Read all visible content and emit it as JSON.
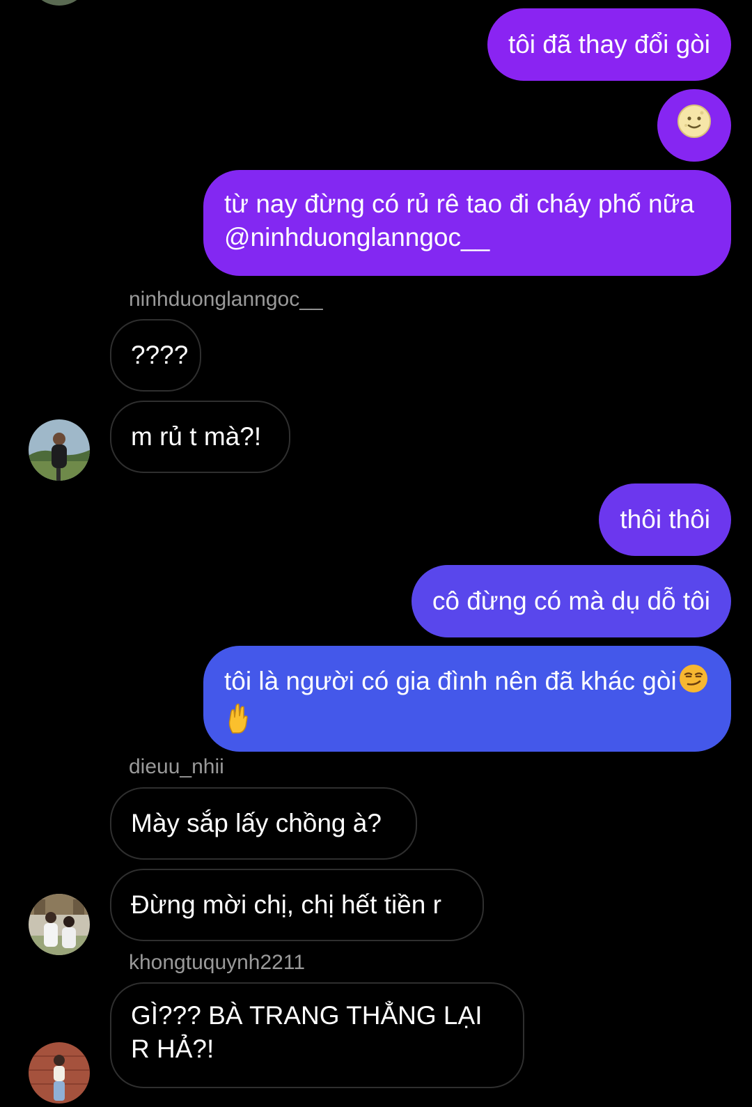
{
  "messages": [
    {
      "from": "me",
      "text": "tôi đã thay đổi gòi"
    },
    {
      "from": "me",
      "emoji": "slightly-smiling-moon-face-icon"
    },
    {
      "from": "me",
      "text": "từ nay đừng có rủ rê tao đi cháy phố nữa @ninhduonglanngoc__"
    },
    {
      "from": "ninhduonglanngoc__",
      "text": "????"
    },
    {
      "from": "ninhduonglanngoc__",
      "text": "m rủ t mà?!"
    },
    {
      "from": "me",
      "text": "thôi thôi"
    },
    {
      "from": "me",
      "text": "cô đừng có mà dụ dỗ tôi"
    },
    {
      "from": "me",
      "text": "tôi là người có gia đình nên đã khác gòi",
      "emojis": [
        "smirking-face-icon",
        "pinching-hand-icon"
      ]
    },
    {
      "from": "dieuu_nhii",
      "text": "Mày sắp lấy chồng à?"
    },
    {
      "from": "dieuu_nhii",
      "text": "Đừng mời chị, chị hết tiền r"
    },
    {
      "from": "khongtuquynh2211",
      "text": "GÌ??? BÀ TRANG THẲNG LẠI R HẢ?!"
    }
  ],
  "senders": {
    "ninhduonglanngoc": "ninhduonglanngoc__",
    "dieuu_nhii": "dieuu_nhii",
    "khongtuquynh2211": "khongtuquynh2211"
  },
  "colors": {
    "background": "#000000",
    "incoming_border": "#2f2f2f",
    "sender_name": "#9a9a9a",
    "gradient_top": "#8a24f2",
    "gradient_bottom": "#4458ea"
  }
}
